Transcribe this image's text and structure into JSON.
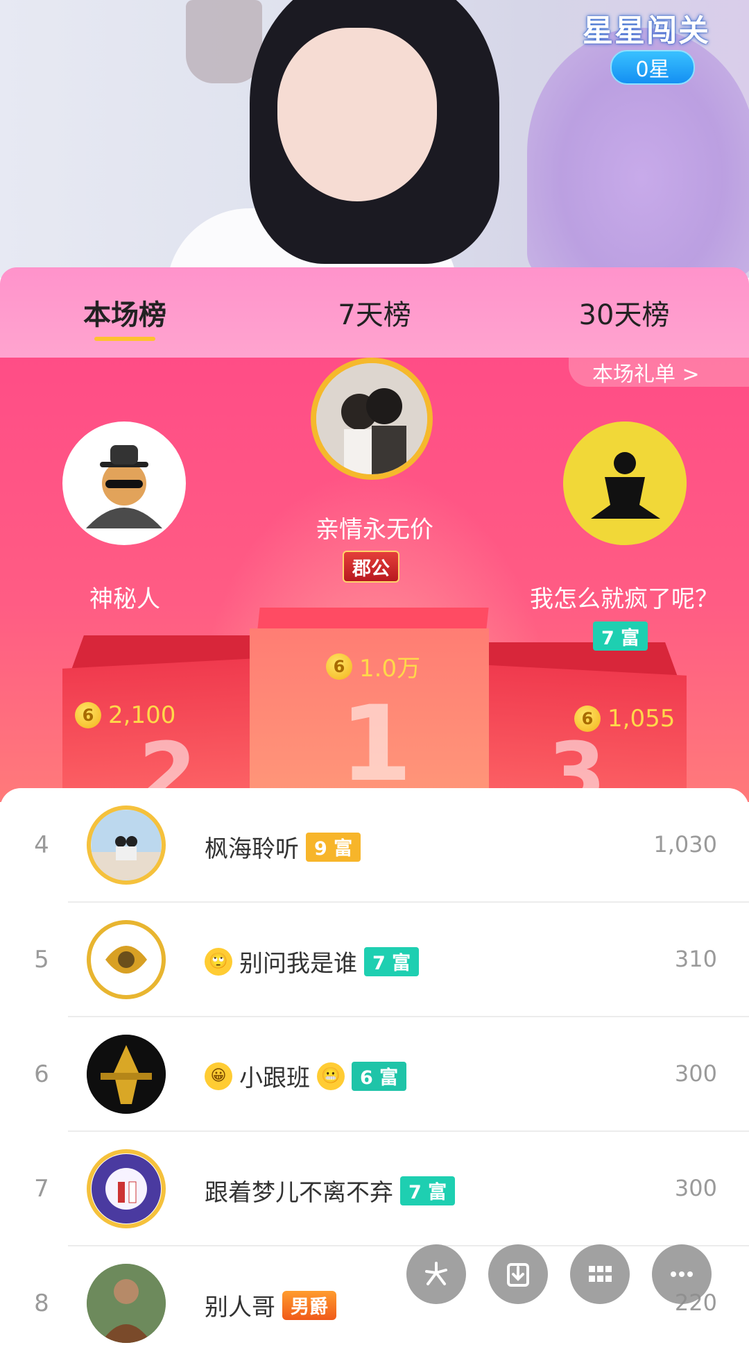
{
  "live": {
    "event_title": "星星闯关",
    "stars_label": "0星"
  },
  "tabs": [
    {
      "label": "本场榜",
      "active": true
    },
    {
      "label": "7天榜",
      "active": false
    },
    {
      "label": "30天榜",
      "active": false
    }
  ],
  "podium": {
    "gift_link": "本场礼单 >",
    "first": {
      "name": "亲情永无价",
      "badge": "郡公",
      "score": "1.0万",
      "rank_mark": "1"
    },
    "second": {
      "name": "神秘人",
      "score": "2,100",
      "rank_mark": "2"
    },
    "third": {
      "name": "我怎么就疯了呢？",
      "badge": "7 富",
      "score": "1,055",
      "rank_mark": "3"
    }
  },
  "coin_glyph": "6",
  "ranking": [
    {
      "rank": "4",
      "name": "枫海聆听",
      "badge": "9 富",
      "badge_type": "fu9",
      "score": "1,030",
      "prefix_emoji": "",
      "suffix_emoji": ""
    },
    {
      "rank": "5",
      "name": "别问我是谁",
      "badge": "7 富",
      "badge_type": "fu7",
      "score": "310",
      "prefix_emoji": "🙄",
      "suffix_emoji": ""
    },
    {
      "rank": "6",
      "name": "小跟班",
      "badge": "6 富",
      "badge_type": "fu6",
      "score": "300",
      "prefix_emoji": "😀",
      "suffix_emoji": "😬"
    },
    {
      "rank": "7",
      "name": "跟着梦儿不离不弃",
      "badge": "7 富",
      "badge_type": "fu7",
      "score": "300",
      "prefix_emoji": "",
      "suffix_emoji": ""
    },
    {
      "rank": "8",
      "name": "别人哥",
      "badge": "男爵",
      "badge_type": "noble",
      "score": "220",
      "prefix_emoji": "",
      "suffix_emoji": ""
    }
  ],
  "floating_buttons": [
    "share-icon",
    "download-icon",
    "apps-icon",
    "more-icon"
  ],
  "colors": {
    "accent": "#ffc12e",
    "tab_bg": "#ff93cb",
    "podium_bg": "#ff4d86",
    "coin": "#ffd84a",
    "fu_badge": "#1ecfb1"
  }
}
